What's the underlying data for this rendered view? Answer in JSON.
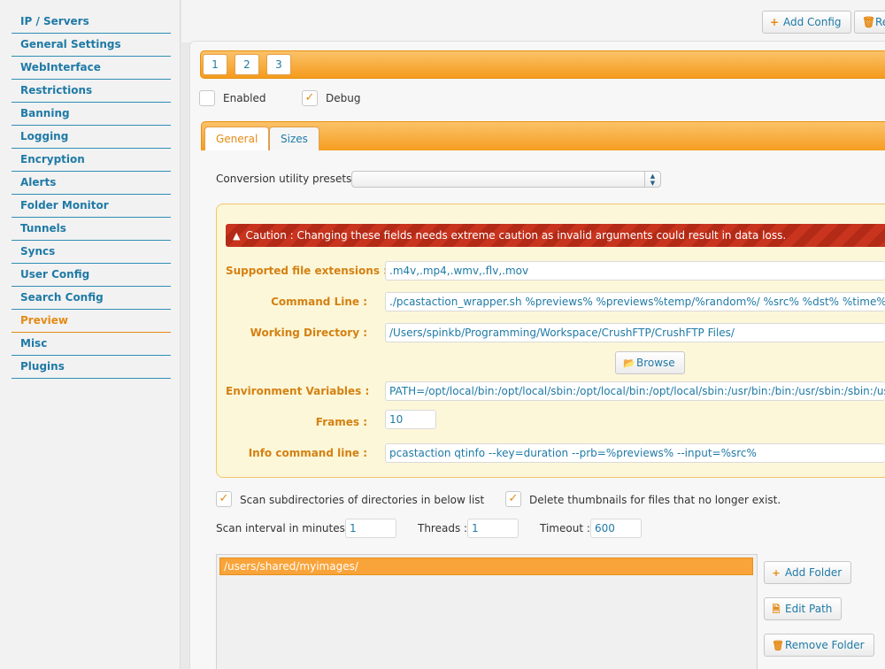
{
  "sidebar": {
    "items": [
      {
        "label": "IP / Servers"
      },
      {
        "label": "General Settings"
      },
      {
        "label": "WebInterface"
      },
      {
        "label": "Restrictions"
      },
      {
        "label": "Banning"
      },
      {
        "label": "Logging"
      },
      {
        "label": "Encryption"
      },
      {
        "label": "Alerts"
      },
      {
        "label": "Folder Monitor"
      },
      {
        "label": "Tunnels"
      },
      {
        "label": "Syncs"
      },
      {
        "label": "User Config"
      },
      {
        "label": "Search Config"
      },
      {
        "label": "Preview"
      },
      {
        "label": "Misc"
      },
      {
        "label": "Plugins"
      }
    ],
    "active_index": 13
  },
  "toolbar": {
    "add_config_label": "Add Config",
    "remove_config_label": "Re"
  },
  "config_tabs": [
    "1",
    "2",
    "3"
  ],
  "options": {
    "enabled_label": "Enabled",
    "enabled_checked": false,
    "debug_label": "Debug",
    "debug_checked": true
  },
  "section_tabs": {
    "general": "General",
    "sizes": "Sizes"
  },
  "presets": {
    "label": "Conversion utility presets :",
    "selected": ""
  },
  "caution": {
    "text": "Caution : Changing these fields needs extreme caution as invalid arguments could result in data loss."
  },
  "fields": {
    "extensions": {
      "label": "Supported file extensions :",
      "value": ".m4v,.mp4,.wmv,.flv,.mov"
    },
    "command_line": {
      "label": "Command Line :",
      "value": "./pcastaction_wrapper.sh %previews% %previews%temp/%random%/ %src% %dst% %time% %width%"
    },
    "working_dir": {
      "label": "Working Directory :",
      "value": "/Users/spinkb/Programming/Workspace/CrushFTP/CrushFTP Files/"
    },
    "browse_label": "Browse",
    "env_vars": {
      "label": "Environment Variables :",
      "value": "PATH=/opt/local/bin:/opt/local/sbin:/opt/local/bin:/opt/local/sbin:/usr/bin:/bin:/usr/sbin:/sbin:/usr"
    },
    "frames": {
      "label": "Frames :",
      "value": "10"
    },
    "info_cmd": {
      "label": "Info command line :",
      "value": "pcastaction qtinfo --key=duration --prb=%previews% --input=%src%"
    }
  },
  "scan": {
    "subdirs_label": "Scan subdirectories of directories in below list",
    "subdirs_checked": true,
    "delete_label": "Delete thumbnails for files that no longer exist.",
    "delete_checked": true,
    "interval_label": "Scan interval in minutes :",
    "interval_value": "1",
    "threads_label": "Threads :",
    "threads_value": "1",
    "timeout_label": "Timeout :",
    "timeout_value": "600"
  },
  "folders": {
    "items": [
      "/users/shared/myimages/"
    ],
    "add_label": "Add Folder",
    "edit_label": "Edit Path",
    "remove_label": "Remove Folder"
  }
}
